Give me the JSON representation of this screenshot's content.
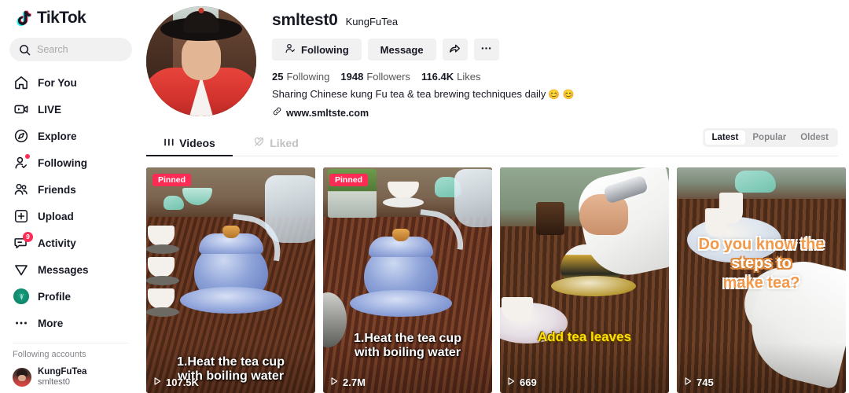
{
  "brand": {
    "name": "TikTok"
  },
  "search": {
    "placeholder": "Search",
    "value": ""
  },
  "sidebar": {
    "items": [
      {
        "label": "For You",
        "icon": "home-icon"
      },
      {
        "label": "LIVE",
        "icon": "live-icon"
      },
      {
        "label": "Explore",
        "icon": "compass-icon"
      },
      {
        "label": "Following",
        "icon": "person-follow-icon",
        "dot": true
      },
      {
        "label": "Friends",
        "icon": "friends-icon"
      },
      {
        "label": "Upload",
        "icon": "upload-plus-icon"
      },
      {
        "label": "Activity",
        "icon": "activity-icon",
        "badge": "9"
      },
      {
        "label": "Messages",
        "icon": "messages-icon"
      },
      {
        "label": "Profile",
        "icon": "profile-avatar-icon"
      },
      {
        "label": "More",
        "icon": "more-dots-icon"
      }
    ],
    "following_accounts_title": "Following accounts",
    "following_accounts": [
      {
        "name": "KungFuTea",
        "handle": "smltest0"
      }
    ]
  },
  "profile": {
    "username": "smltest0",
    "nickname": "KungFuTea",
    "buttons": {
      "following": "Following",
      "message": "Message",
      "share": "share-icon",
      "more": "more-icon"
    },
    "stats": {
      "following_count": "25",
      "following_label": "Following",
      "followers_count": "1948",
      "followers_label": "Followers",
      "likes_count": "116.4K",
      "likes_label": "Likes"
    },
    "bio": "Sharing Chinese kung Fu tea & tea brewing techniques daily",
    "bio_emoji": "😊 😊",
    "website": "www.smltste.com"
  },
  "tabs": [
    {
      "label": "Videos",
      "icon": "grid-icon",
      "active": true
    },
    {
      "label": "Liked",
      "icon": "heart-lock-icon",
      "active": false
    }
  ],
  "sort": {
    "options": [
      {
        "label": "Latest",
        "active": true
      },
      {
        "label": "Popular",
        "active": false
      },
      {
        "label": "Oldest",
        "active": false
      }
    ]
  },
  "videos": [
    {
      "pinned_label": "Pinned",
      "pinned": true,
      "caption_line1": "1.Heat the tea cup",
      "caption_line2": "with boiling water",
      "views": "107.5K"
    },
    {
      "pinned_label": "Pinned",
      "pinned": true,
      "caption_line1": "1.Heat the tea cup",
      "caption_line2": "with boiling water",
      "views": "2.7M"
    },
    {
      "pinned": false,
      "caption_line1": "Add tea leaves",
      "caption_line2": "",
      "views": "669"
    },
    {
      "pinned": false,
      "caption_line1": "Do you know the",
      "caption_line2": "steps  to",
      "caption_line3": "make tea?",
      "views": "745"
    }
  ],
  "colors": {
    "accent_pink": "#FE2C55",
    "accent_cyan": "#25F4EE",
    "text_primary": "#161823",
    "bg_grey": "#F1F1F2"
  }
}
